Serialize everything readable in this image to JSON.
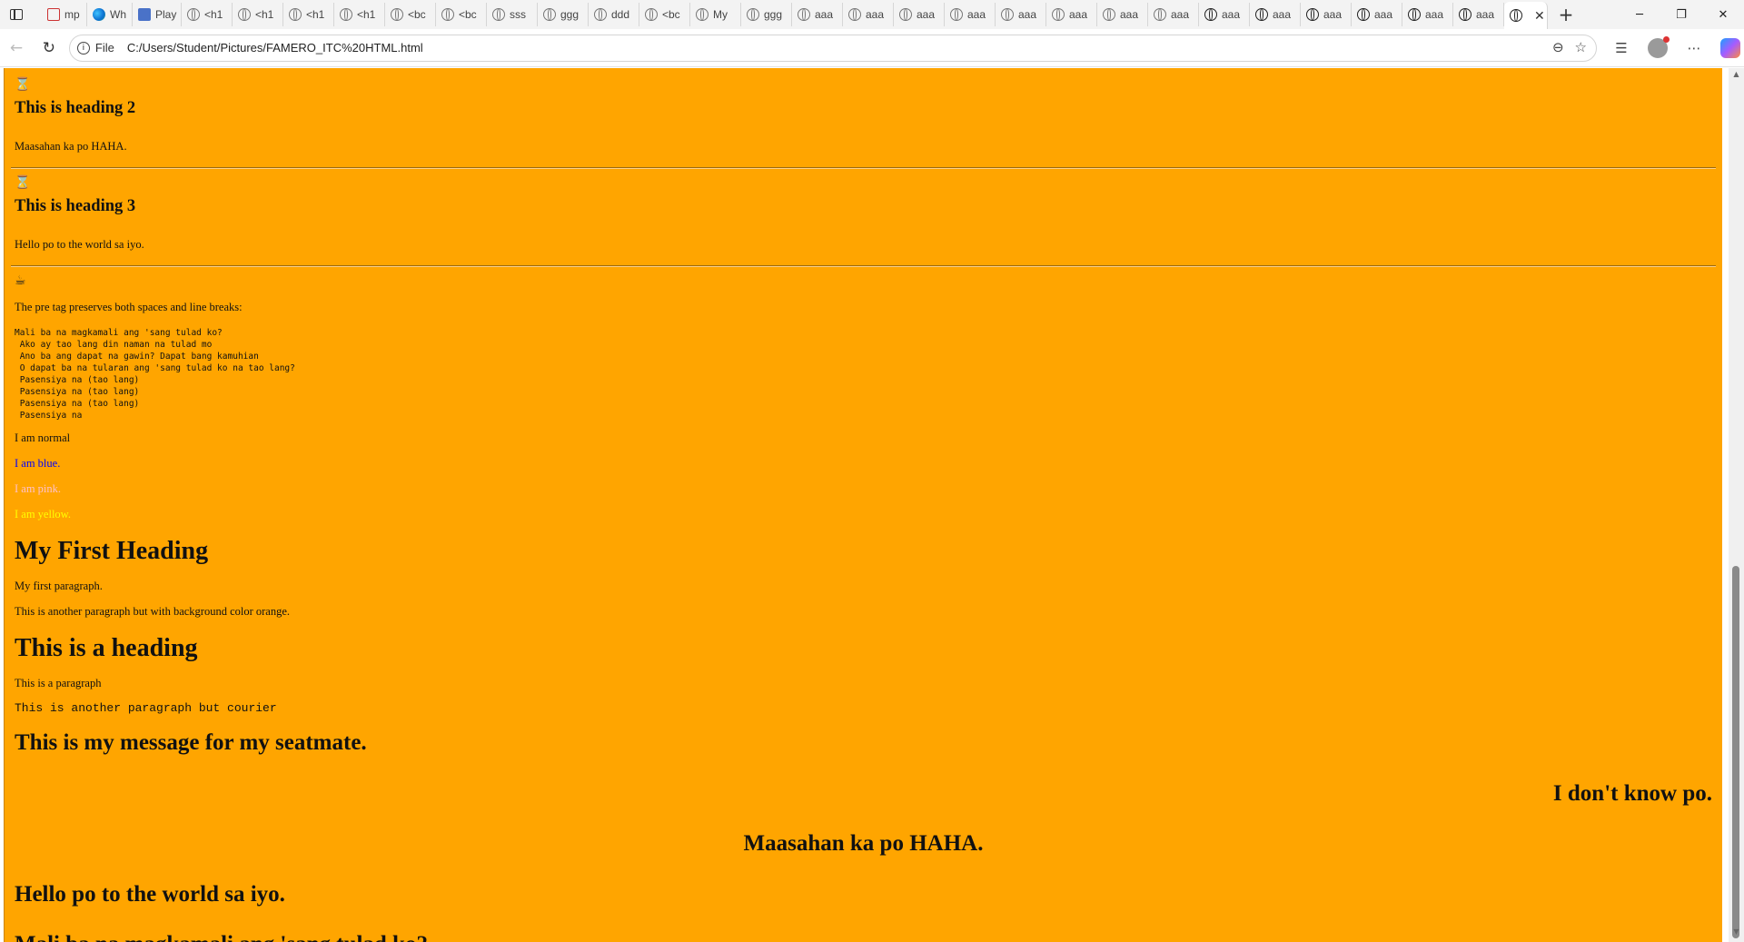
{
  "browser": {
    "tabs": [
      {
        "label": "",
        "icon": "window-menu-icon"
      },
      {
        "label": "mp",
        "icon": "pdf-icon"
      },
      {
        "label": "Wh",
        "icon": "edge-icon"
      },
      {
        "label": "Play",
        "icon": "play-icon"
      },
      {
        "label": "<h1",
        "icon": "globe-icon"
      },
      {
        "label": "<h1",
        "icon": "globe-icon"
      },
      {
        "label": "<h1",
        "icon": "globe-icon"
      },
      {
        "label": "<h1",
        "icon": "globe-icon"
      },
      {
        "label": "<bc",
        "icon": "globe-icon"
      },
      {
        "label": "<bc",
        "icon": "globe-icon"
      },
      {
        "label": "sss",
        "icon": "globe-icon"
      },
      {
        "label": "ggg",
        "icon": "globe-icon"
      },
      {
        "label": "ddd",
        "icon": "globe-icon"
      },
      {
        "label": "<bc",
        "icon": "globe-icon"
      },
      {
        "label": "My",
        "icon": "globe-icon"
      },
      {
        "label": "ggg",
        "icon": "globe-icon"
      },
      {
        "label": "aaa",
        "icon": "globe-icon"
      },
      {
        "label": "aaa",
        "icon": "globe-icon"
      },
      {
        "label": "aaa",
        "icon": "globe-icon"
      },
      {
        "label": "aaa",
        "icon": "globe-icon"
      },
      {
        "label": "aaa",
        "icon": "globe-icon"
      },
      {
        "label": "aaa",
        "icon": "globe-icon"
      },
      {
        "label": "aaa",
        "icon": "globe-icon"
      },
      {
        "label": "aaa",
        "icon": "globe-icon"
      },
      {
        "label": "aaa",
        "icon": "globe-dark-icon"
      },
      {
        "label": "aaa",
        "icon": "globe-dark-icon"
      },
      {
        "label": "aaa",
        "icon": "globe-dark-icon"
      },
      {
        "label": "aaa",
        "icon": "globe-dark-icon"
      },
      {
        "label": "aaa",
        "icon": "globe-dark-icon"
      },
      {
        "label": "aaa",
        "icon": "globe-dark-icon"
      }
    ],
    "active_tab_close": "✕",
    "new_tab": "+",
    "window_controls": {
      "minimize": "─",
      "maximize": "❐",
      "close": "✕"
    },
    "address": {
      "scheme_label": "File",
      "url": "C:/Users/Student/Pictures/FAMERO_ITC%20HTML.html"
    }
  },
  "page": {
    "background": "#ffa500",
    "heading2_icon": "⌛",
    "heading2": "This is heading 2",
    "heading2_text": "Maasahan ka po HAHA.",
    "heading3_icon": "⌛",
    "heading3": "This is heading 3",
    "heading3_text": "Hello po to the world sa iyo.",
    "pre_icon": "☕",
    "pre_intro": "The pre tag preserves both spaces and line breaks:",
    "pre_text": "Mali ba na magkamali ang 'sang tulad ko?\n Ako ay tao lang din naman na tulad mo\n Ano ba ang dapat na gawin? Dapat bang kamuhian\n O dapat ba na tularan ang 'sang tulad ko na tao lang?\n Pasensiya na (tao lang)\n Pasensiya na (tao lang)\n Pasensiya na (tao lang)\n Pasensiya na",
    "normal_text": "I am normal",
    "blue_text": "I am blue.",
    "pink_text": "I am pink.",
    "yellow_text": "I am yellow.",
    "colors": {
      "blue": "#0000ff",
      "pink": "#ffc0cb",
      "yellow": "#ffff00"
    },
    "first_heading": "My First Heading",
    "first_paragraph": "My first paragraph.",
    "another_paragraph": "This is another paragraph but with background color orange.",
    "a_heading": "This is a heading",
    "a_paragraph": "This is a paragraph",
    "courier_paragraph": "This is another paragraph but courier",
    "seatmate_heading": "This is my message for my seatmate.",
    "right_heading": "I don't know po.",
    "center_heading": "Maasahan ka po HAHA.",
    "left_heading": "Hello po to the world sa iyo.",
    "cut_heading": "Mali ba na magkamali ang 'sang tulad ko?"
  }
}
